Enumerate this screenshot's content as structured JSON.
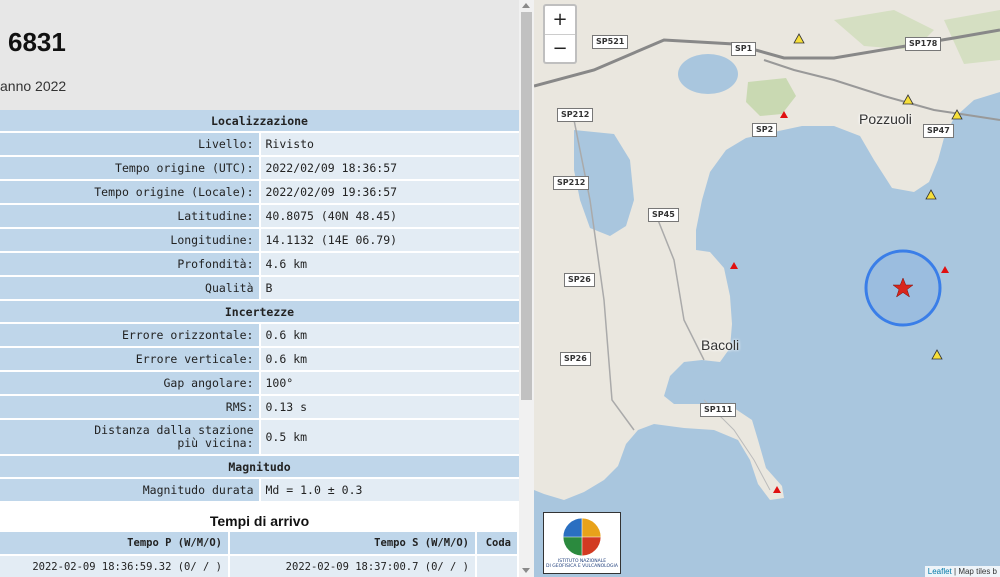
{
  "event": {
    "id": "6831",
    "subtitle": "anno 2022"
  },
  "info": {
    "localizzazione": {
      "title": "Localizzazione",
      "rows": [
        {
          "label": "Livello:",
          "value": "Rivisto"
        },
        {
          "label": "Tempo origine (UTC):",
          "value": "2022/02/09 18:36:57"
        },
        {
          "label": "Tempo origine (Locale):",
          "value": "2022/02/09 19:36:57"
        },
        {
          "label": "Latitudine:",
          "value": "40.8075 (40N 48.45)"
        },
        {
          "label": "Longitudine:",
          "value": "14.1132 (14E 06.79)"
        },
        {
          "label": "Profondità:",
          "value": "4.6 km"
        },
        {
          "label": "Qualità",
          "value": "B"
        }
      ]
    },
    "incertezze": {
      "title": "Incertezze",
      "rows": [
        {
          "label": "Errore orizzontale:",
          "value": "0.6 km"
        },
        {
          "label": "Errore verticale:",
          "value": "0.6 km"
        },
        {
          "label": "Gap angolare:",
          "value": "100°"
        },
        {
          "label": "RMS:",
          "value": "0.13 s"
        },
        {
          "label_line1": "Distanza dalla stazione",
          "label_line2": "più vicina:",
          "value": "0.5 km"
        }
      ]
    },
    "magnitudo": {
      "title": "Magnitudo",
      "rows": [
        {
          "label": "Magnitudo durata",
          "value": "Md = 1.0 ± 0.3"
        }
      ]
    }
  },
  "arrivals": {
    "title": "Tempi di arrivo",
    "headers": [
      "Tempo P (W/M/O)",
      "Tempo S (W/M/O)",
      "Coda"
    ],
    "rows": [
      [
        "2022-02-09 18:36:59.32 (0/ / )",
        "2022-02-09 18:37:00.7 (0/ / )",
        ""
      ]
    ]
  },
  "map": {
    "roads": [
      "SP521",
      "SP1",
      "SP178",
      "SP212",
      "SP2",
      "SP47",
      "SP212",
      "SP45",
      "SP26",
      "SP26",
      "SP111"
    ],
    "towns": [
      "Pozzuoli",
      "Bacoli"
    ],
    "zoom_in": "+",
    "zoom_out": "−",
    "logo_line1": "ISTITUTO NAZIONALE",
    "logo_line2": "DI GEOFISICA E VULCANOLOGIA",
    "attribution_link": "Leaflet",
    "attribution_text": "| Map tiles b",
    "colors": {
      "sea": "#a9c6de",
      "land": "#eae7df",
      "epicenter": "#d9261c",
      "error_circle": "#3a7ee8",
      "station_red": "#e01010",
      "station_yellow": "#f7df3a"
    }
  }
}
